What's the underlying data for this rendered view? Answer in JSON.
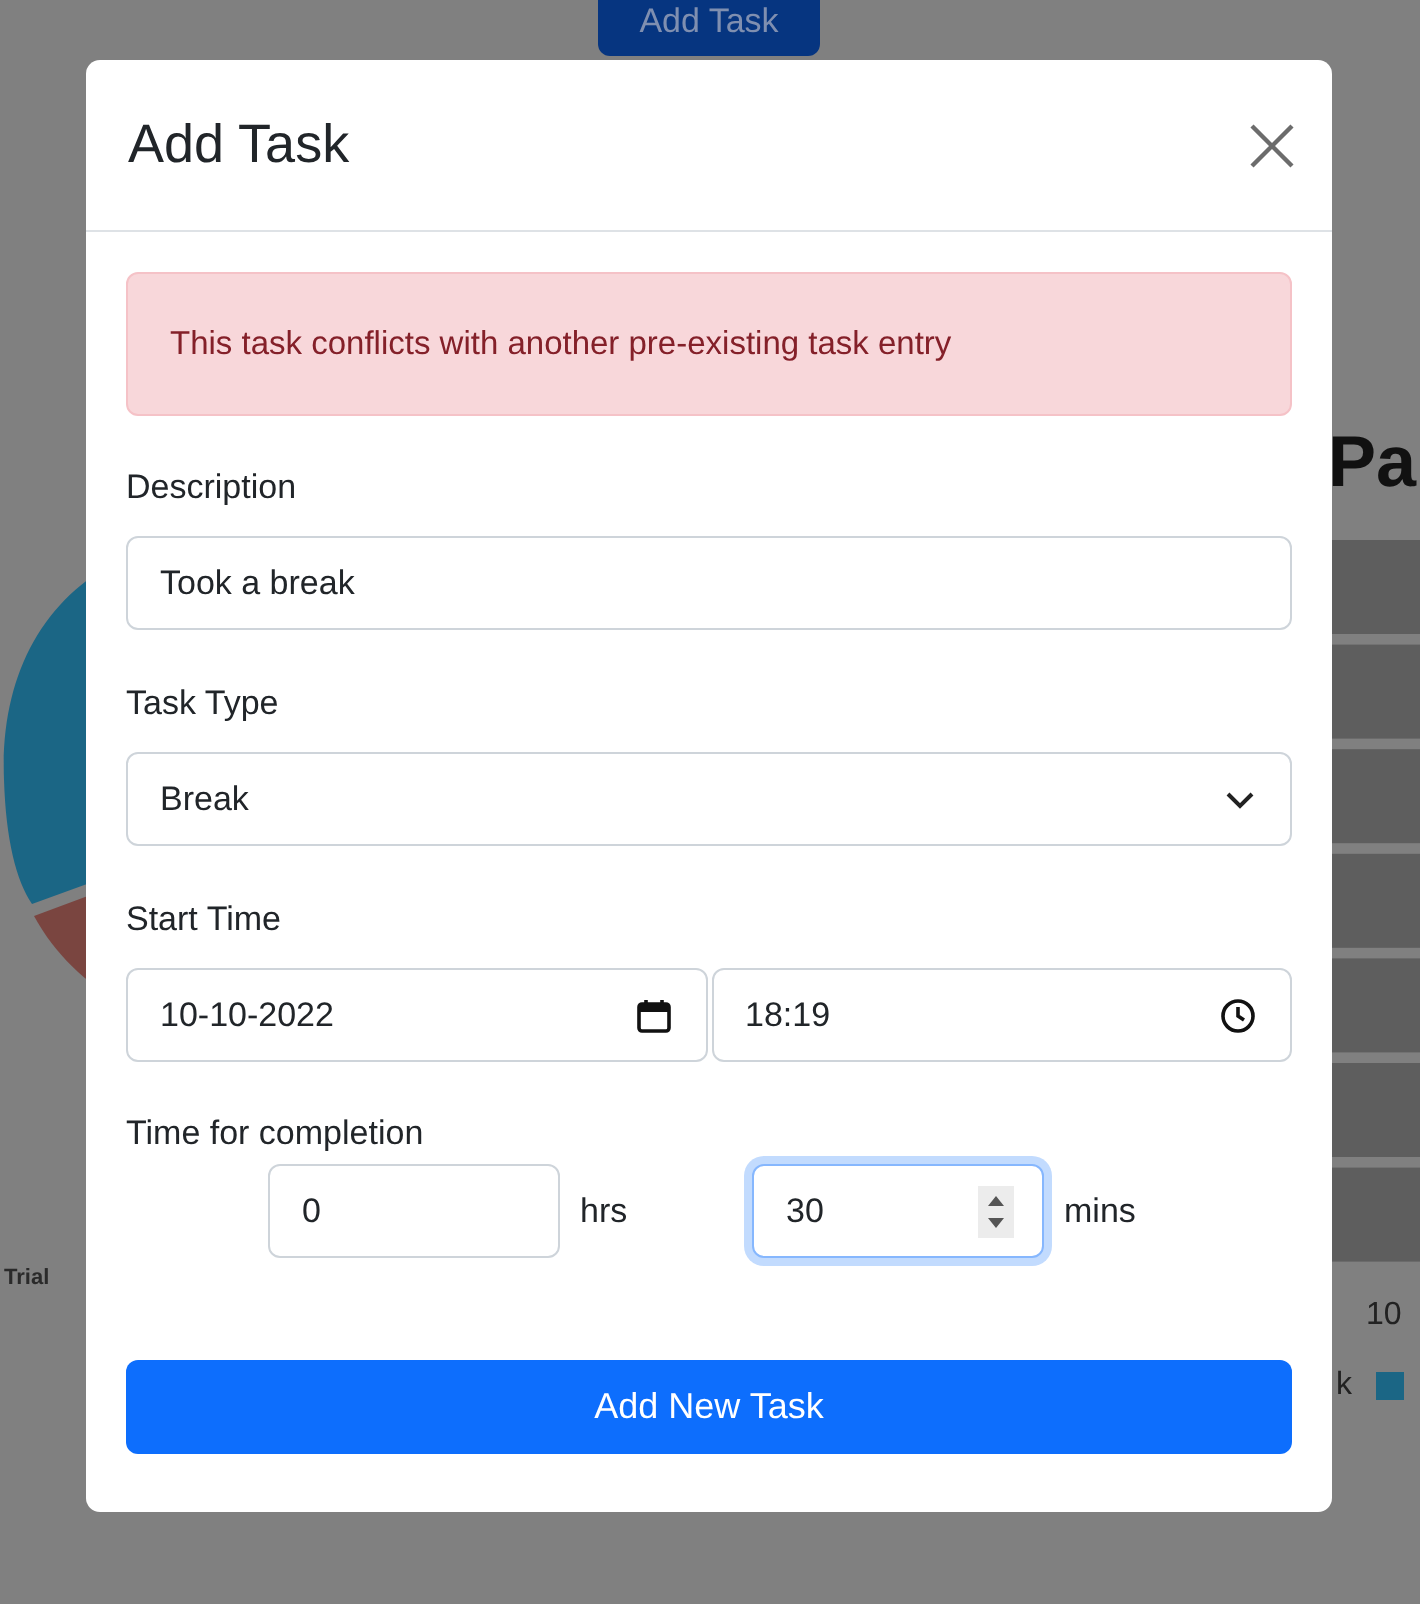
{
  "background": {
    "add_button": "Add Task",
    "pie_label": "Trial",
    "chart_title": "Pa",
    "axis_tick": "10",
    "legend": [
      "k"
    ]
  },
  "modal": {
    "title": "Add Task",
    "alert": "This task conflicts with another pre-existing task entry",
    "description": {
      "label": "Description",
      "value": "Took a break"
    },
    "task_type": {
      "label": "Task Type",
      "value": "Break"
    },
    "start_time": {
      "label": "Start Time",
      "date": "10-10-2022",
      "time": "18:19"
    },
    "completion": {
      "label": "Time for completion",
      "fields": [
        {
          "value": "0",
          "unit": "hrs",
          "focused": false
        },
        {
          "value": "30",
          "unit": "mins",
          "focused": true
        }
      ]
    },
    "submit": "Add New Task"
  }
}
